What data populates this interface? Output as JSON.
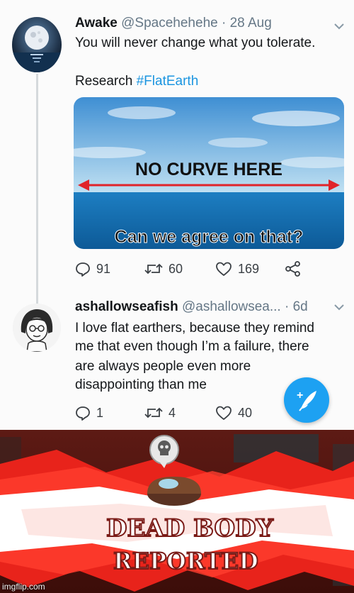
{
  "tweet1": {
    "name": "Awake",
    "handle": "@Spacehehehe",
    "separator": "·",
    "date": "28 Aug",
    "text_line1": "You will never change what you tolerate.",
    "text_line2_prefix": "Research ",
    "hashtag": "#FlatEarth",
    "image": {
      "caption_top": "NO CURVE HERE",
      "caption_bottom": "Can we agree on that?"
    },
    "replies": "91",
    "retweets": "60",
    "likes": "169"
  },
  "tweet2": {
    "name": "ashallowseafish",
    "handle": "@ashallowsea...",
    "separator": "·",
    "date": "6d",
    "lines": [
      "I love flat earthers, because they remind",
      "me that even though I’m a failure, there",
      "are always people even more",
      "disappointing than me"
    ],
    "replies": "1",
    "retweets": "4",
    "likes": "40"
  },
  "icons": [
    "reply-icon",
    "retweet-icon",
    "like-icon",
    "share-icon",
    "chevron-down-icon",
    "compose-icon",
    "skull-icon"
  ],
  "colors": {
    "link": "#1b95e0",
    "compose_button": "#1da1f2",
    "meme_red": "#e8231b",
    "text": "#14171a",
    "muted": "#657786"
  },
  "meme": {
    "line1": "DEAD BODY",
    "line2": "REPORTED"
  },
  "watermark": "imgflip.com"
}
